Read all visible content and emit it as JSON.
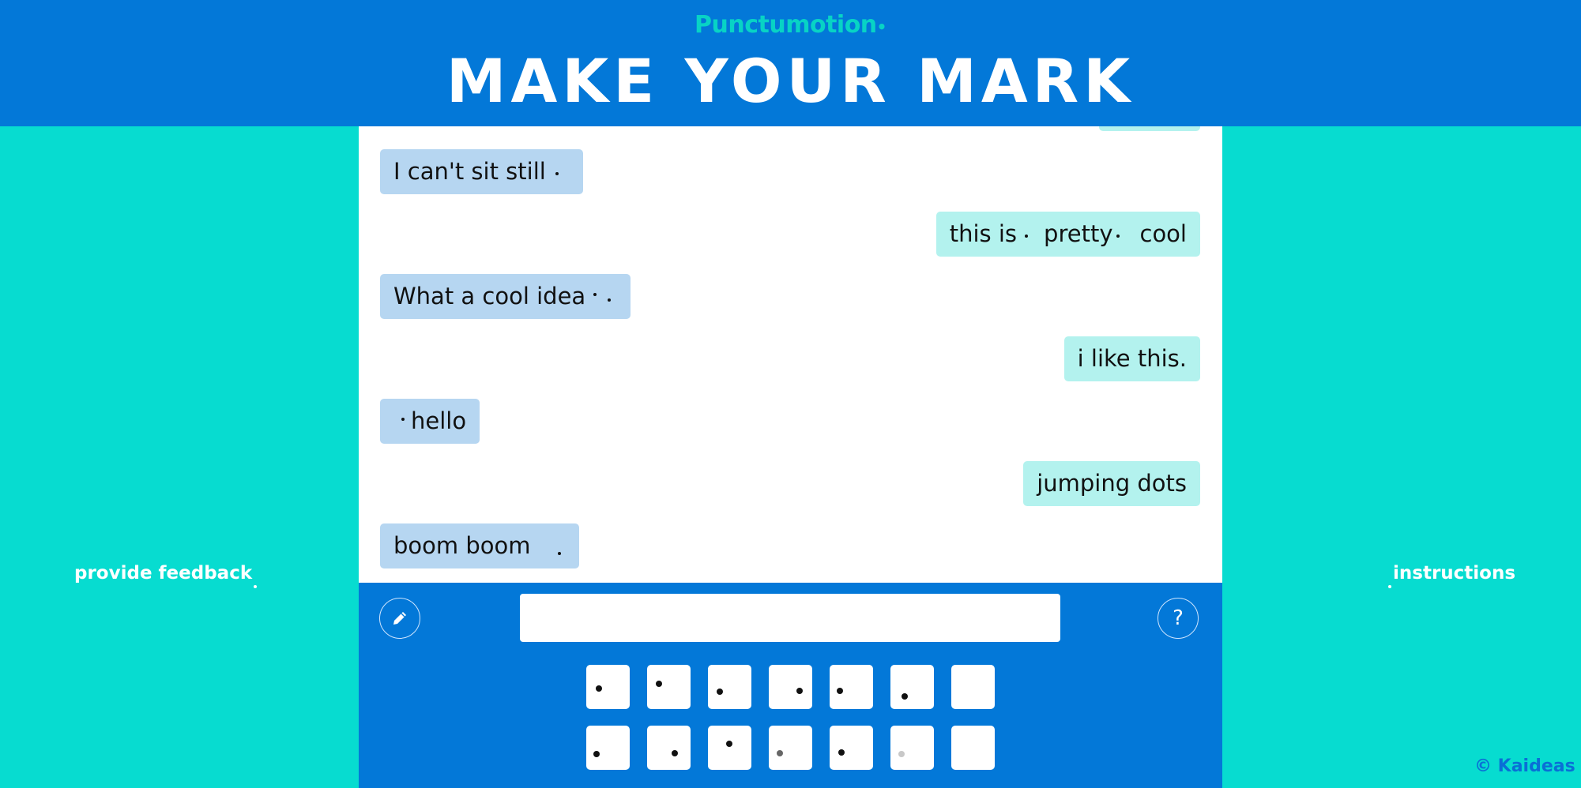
{
  "header": {
    "brand": "Punctumotion",
    "headline": "MAKE YOUR MARK"
  },
  "side_links": {
    "feedback": "provide feedback",
    "instructions": "instructions"
  },
  "footer": {
    "copyright": "© Kaideas"
  },
  "messages": [
    {
      "side": "left",
      "text_parts": [
        "I can't sit still",
        ""
      ]
    },
    {
      "side": "right",
      "text_parts": [
        "this is",
        "pretty",
        "cool"
      ]
    },
    {
      "side": "left",
      "text_parts": [
        "What a cool idea",
        "",
        ""
      ]
    },
    {
      "side": "right",
      "text_parts": [
        "i like this."
      ]
    },
    {
      "side": "left",
      "text_parts": [
        "",
        "hello"
      ]
    },
    {
      "side": "right",
      "text_parts": [
        "jumping dots"
      ]
    },
    {
      "side": "left",
      "text_parts": [
        "boom boom",
        ""
      ]
    }
  ],
  "composer": {
    "input_value": "",
    "input_placeholder": "",
    "pencil_button_icon": "pencil-icon",
    "help_button_label": "?"
  },
  "colors": {
    "header_blue": "#0378d8",
    "side_teal": "#07dcd0",
    "bubble_left": "#b6d6f1",
    "bubble_right": "#b3f2ee",
    "brand_teal": "#08d3c5"
  }
}
